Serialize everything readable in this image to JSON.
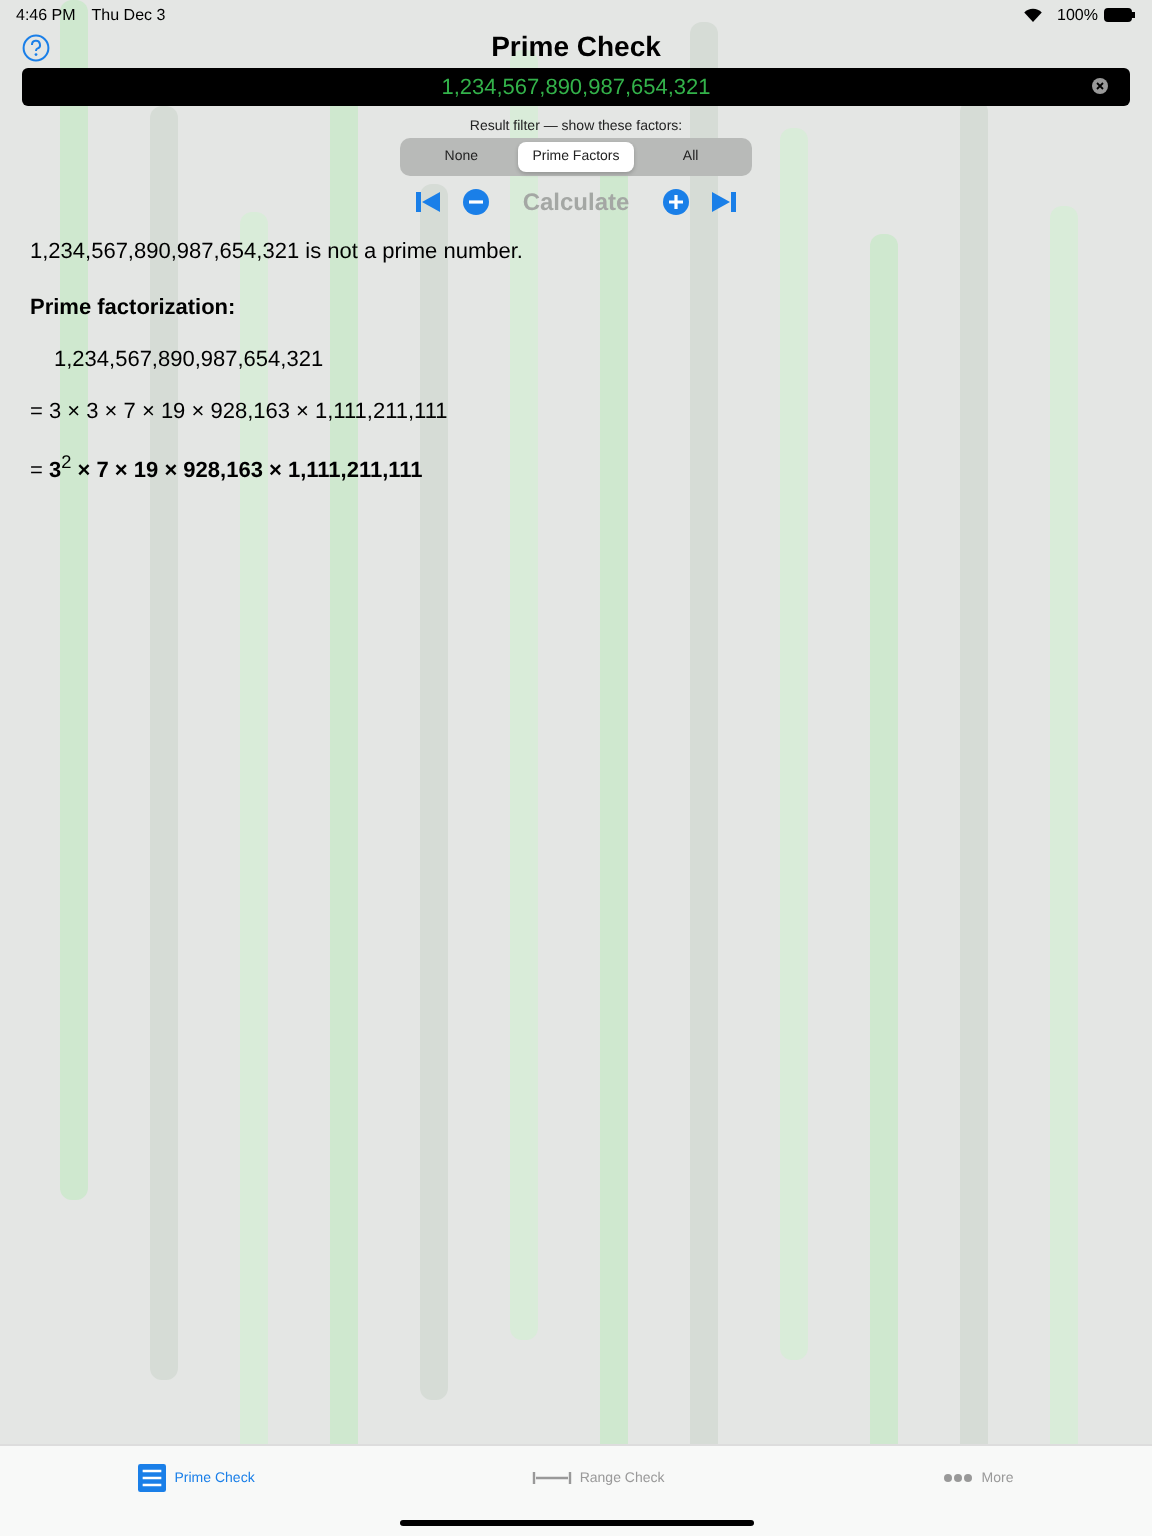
{
  "status_bar": {
    "time": "4:46 PM",
    "date": "Thu Dec 3",
    "battery": "100%"
  },
  "nav": {
    "title": "Prime Check"
  },
  "number_field": {
    "value": "1,234,567,890,987,654,321"
  },
  "filter": {
    "label": "Result filter — show these factors:",
    "segments": [
      {
        "label": "None",
        "selected": false
      },
      {
        "label": "Prime Factors",
        "selected": true
      },
      {
        "label": "All",
        "selected": false
      }
    ]
  },
  "controls": {
    "calculate": {
      "label": "Calculate",
      "disabled": true
    }
  },
  "result": {
    "statement": "1,234,567,890,987,654,321 is not a prime number.",
    "heading": "Prime factorization:",
    "lines": [
      "1,234,567,890,987,654,321",
      "=  3 × 3 × 7 × 19 × 928,163 × 1,111,211,111",
      "=  **3**$^{2}$ **× 7 × 19 × 928,163 × 1,111,211,111**"
    ]
  },
  "tab_bar": [
    {
      "kind": "grid",
      "label": "Prime Check",
      "selected": true
    },
    {
      "kind": "range",
      "label": "Range Check",
      "selected": false
    },
    {
      "kind": "more",
      "label": "More",
      "selected": false
    }
  ]
}
